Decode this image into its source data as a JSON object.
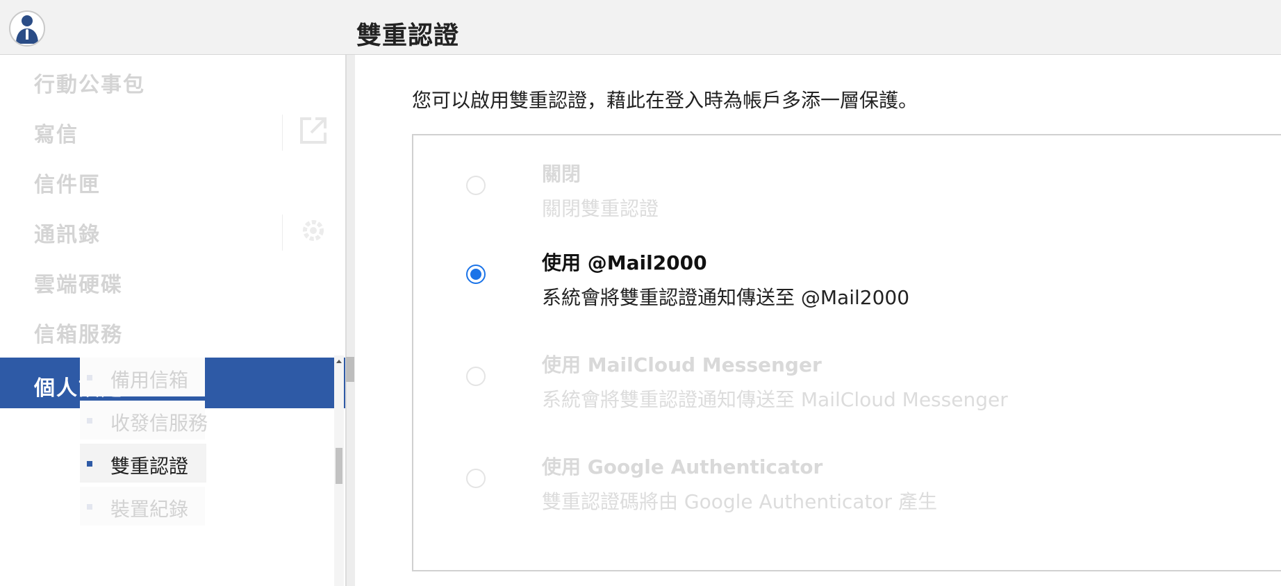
{
  "header": {
    "title": "雙重認證",
    "avatar_icon": "user-avatar-icon"
  },
  "sidebar": {
    "items": [
      {
        "label": "行動公事包"
      },
      {
        "label": "寫信",
        "side_icon": "open-new-window-icon"
      },
      {
        "label": "信件匣"
      },
      {
        "label": "通訊錄",
        "side_icon": "gear-icon"
      },
      {
        "label": "雲端硬碟"
      },
      {
        "label": "信箱服務"
      },
      {
        "label": "個人設定",
        "active": true
      }
    ],
    "sub_items": [
      {
        "label": "備用信箱"
      },
      {
        "label": "收發信服務"
      },
      {
        "label": "雙重認證",
        "current": true
      },
      {
        "label": "裝置紀錄"
      }
    ]
  },
  "main": {
    "intro": "您可以啟用雙重認證，藉此在登入時為帳戶多添一層保護。",
    "options": [
      {
        "title": "關閉",
        "desc": "關閉雙重認證",
        "selected": false
      },
      {
        "title": "使用 @Mail2000",
        "desc": "系統會將雙重認證通知傳送至 @Mail2000",
        "selected": true
      },
      {
        "title": "使用 MailCloud Messenger",
        "desc": "系統會將雙重認證通知傳送至 MailCloud Messenger",
        "selected": false
      },
      {
        "title": "使用 Google Authenticator",
        "desc": "雙重認證碼將由 Google Authenticator 產生",
        "selected": false
      }
    ]
  },
  "colors": {
    "accent": "#2e5aa6",
    "radio_selected": "#1a73e8"
  }
}
